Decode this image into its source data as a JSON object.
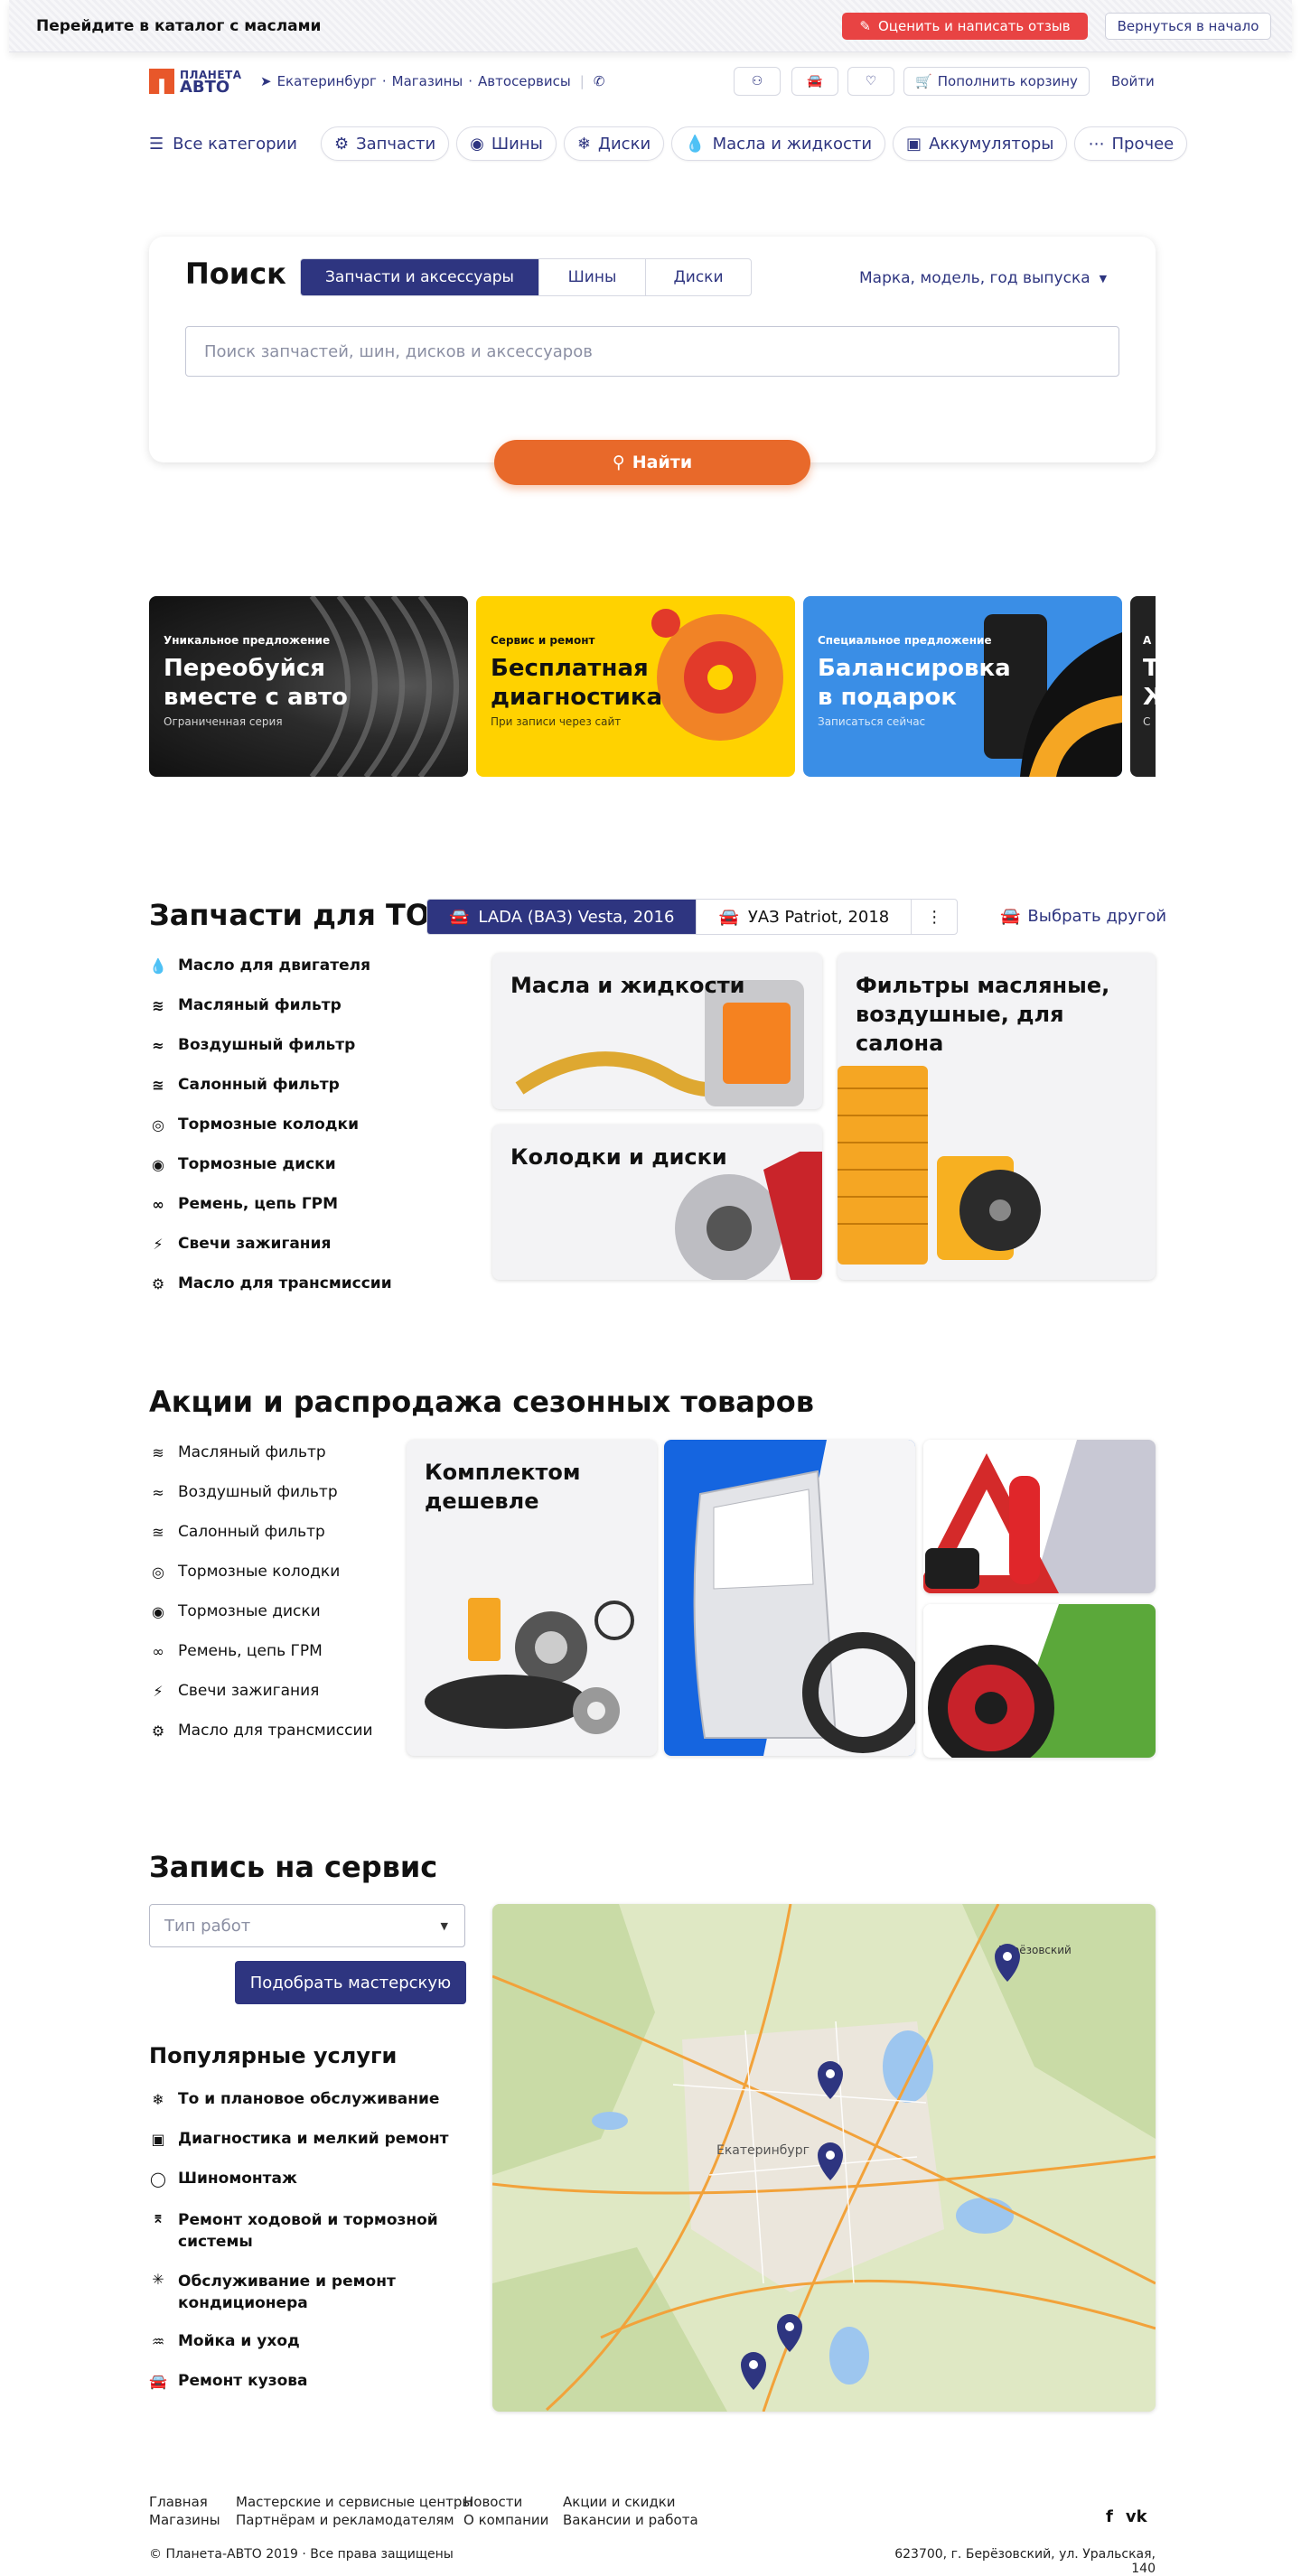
{
  "topbar": {
    "title": "Перейдите в каталог с маслами",
    "review_label": "Оценить и написать отзыв",
    "back_label": "Вернуться в начало"
  },
  "header": {
    "logo_line1": "ПЛАНЕТА",
    "logo_line2": "АВТО",
    "city": "Екатеринбург",
    "shops": "Магазины",
    "services": "Автосервисы",
    "cart_label": "Пополнить корзину",
    "login_label": "Войти"
  },
  "nav": {
    "all_label": "Все категории",
    "pills": [
      "Запчасти",
      "Шины",
      "Диски",
      "Масла и жидкости",
      "Аккумуляторы",
      "Прочее"
    ]
  },
  "search": {
    "title": "Поиск",
    "tabs": [
      "Запчасти и аксессуары",
      "Шины",
      "Диски"
    ],
    "active_tab": 0,
    "brand_select": "Марка, модель, год выпуска",
    "placeholder": "Поиск запчастей, шин, дисков и аксессуаров",
    "button": "Найти"
  },
  "banners": [
    {
      "kicker": "Уникальное предложение",
      "title1": "Переобуйся",
      "title2": "вместе с авто",
      "sub": "Ограниченная серия"
    },
    {
      "kicker": "Сервис и ремонт",
      "title1": "Бесплатная",
      "title2": "диагностика",
      "sub": "При записи через сайт"
    },
    {
      "kicker": "Специальное предложение",
      "title1": "Балансировка",
      "title2": "в подарок",
      "sub": "Записаться сейчас"
    },
    {
      "kicker": "А",
      "title1": "Т",
      "title2": "Ж",
      "sub": "С"
    }
  ],
  "parts": {
    "title": "Запчасти для ТО",
    "cars": [
      "LADA (ВАЗ) Vesta, 2016",
      "УАЗ Patriot, 2018"
    ],
    "choose_label": "Выбрать другой",
    "list": [
      "Масло для двигателя",
      "Масляный фильтр",
      "Воздушный фильтр",
      "Салонный фильтр",
      "Тормозные колодки",
      "Тормозные диски",
      "Ремень, цепь ГРМ",
      "Свечи зажигания",
      "Масло для трансмиссии"
    ],
    "tiles": {
      "oils": "Масла и жидкости",
      "filters1": "Фильтры масляные,",
      "filters2": "воздушные, для салона",
      "pads": "Колодки и диски"
    }
  },
  "sale": {
    "title": "Акции и распродажа сезонных товаров",
    "list": [
      "Масляный фильтр",
      "Воздушный фильтр",
      "Салонный фильтр",
      "Тормозные колодки",
      "Тормозные диски",
      "Ремень, цепь ГРМ",
      "Свечи зажигания",
      "Масло для трансмиссии"
    ],
    "kit1": "Комплектом",
    "kit2": "дешевле"
  },
  "service": {
    "title": "Запись на сервис",
    "select_placeholder": "Тип работ",
    "button": "Подобрать мастерскую",
    "popular_title": "Популярные услуги",
    "popular": [
      "То и плановое обслуживание",
      "Диагностика и мелкий ремонт",
      "Шиномонтаж",
      "Ремонт ходовой и тормозной",
      "системы",
      "Обслуживание и ремонт",
      "кондиционера",
      "Мойка и уход",
      "Ремонт кузова"
    ],
    "map_city": "Екатеринбург",
    "map_town": "Берёзовский"
  },
  "footer": {
    "c1": [
      "Главная",
      "Магазины"
    ],
    "c2": [
      "Мастерские и сервисные центры",
      "Партнёрам и рекламодателям"
    ],
    "c3": [
      "Новости",
      "О компании"
    ],
    "c4": [
      "Акции и скидки",
      "Вакансии и работа"
    ],
    "copyright": "© Планета-АВТО 2019 · Все права защищены",
    "address": "623700, г. Берёзовский, ул. Уральская, 140",
    "social": [
      "f",
      "vk"
    ]
  },
  "colors": {
    "brand": "#2e3580",
    "accent": "#e8692a",
    "alert": "#e84343"
  }
}
